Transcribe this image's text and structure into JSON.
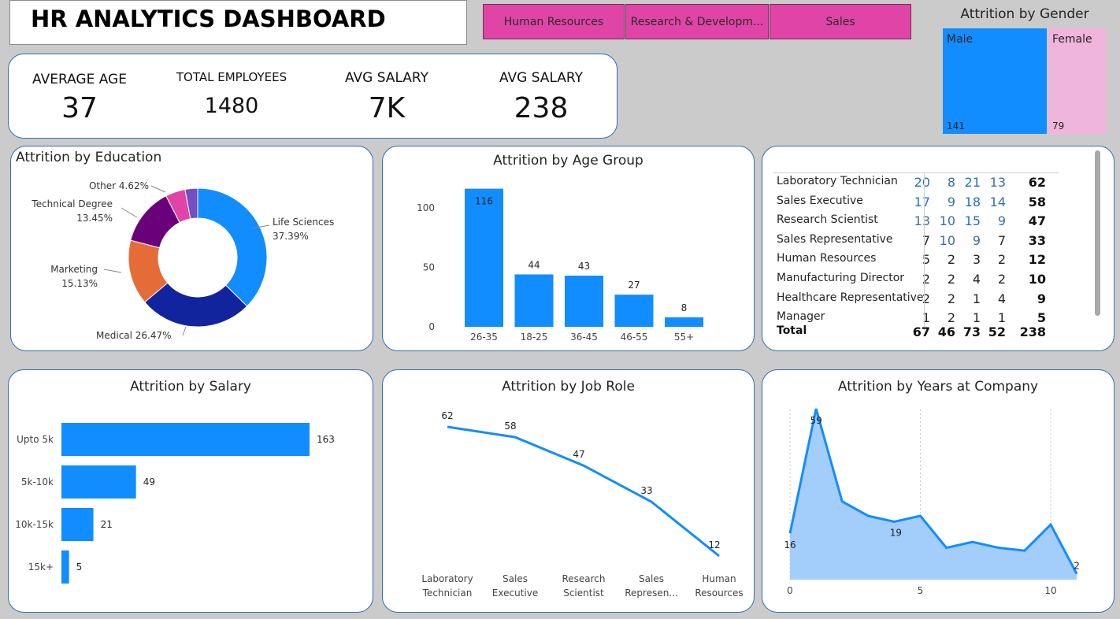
{
  "dashboard": {
    "title": "HR ANALYTICS DASHBOARD",
    "menu_dots": "..."
  },
  "slicer": {
    "buttons": [
      "Human Resources",
      "Research & Developm...",
      "Sales"
    ],
    "color": "#e044a7"
  },
  "kpis": [
    {
      "label": "AVERAGE AGE",
      "value": "37"
    },
    {
      "label": "TOTAL EMPLOYEES",
      "value": "1480"
    },
    {
      "label": "AVG SALARY",
      "value": "7K"
    },
    {
      "label": "AVG SALARY",
      "value": "238"
    }
  ],
  "gender": {
    "title": "Attrition by Gender",
    "male_label": "Male",
    "male_value": "141",
    "female_label": "Female",
    "female_value": "79",
    "male_color": "#118dff",
    "female_color": "#f0b5dc"
  },
  "matrix": {
    "rows": [
      {
        "role": "Laboratory Technician",
        "values": [
          "20",
          "8",
          "21",
          "13"
        ],
        "total": "62"
      },
      {
        "role": "Sales Executive",
        "values": [
          "17",
          "9",
          "18",
          "14"
        ],
        "total": "58"
      },
      {
        "role": "Research Scientist",
        "values": [
          "13",
          "10",
          "15",
          "9"
        ],
        "total": "47"
      },
      {
        "role": "Sales Representative",
        "values": [
          "7",
          "10",
          "9",
          "7"
        ],
        "total": "33"
      },
      {
        "role": "Human Resources",
        "values": [
          "5",
          "2",
          "3",
          "2"
        ],
        "total": "12"
      },
      {
        "role": "Manufacturing Director",
        "values": [
          "2",
          "2",
          "4",
          "2"
        ],
        "total": "10"
      },
      {
        "role": "Healthcare Representative",
        "values": [
          "2",
          "2",
          "1",
          "4"
        ],
        "total": "9"
      },
      {
        "role": "Manager",
        "values": [
          "1",
          "2",
          "1",
          "1"
        ],
        "total": "5"
      }
    ],
    "total_label": "Total",
    "totals": [
      "67",
      "46",
      "73",
      "52"
    ],
    "grand_total": "238"
  },
  "chart_data": [
    {
      "type": "pie",
      "title": "Attrition by Education",
      "categories": [
        "Life Sciences",
        "Medical",
        "Marketing",
        "Technical Degree",
        "Other",
        ""
      ],
      "values": [
        37.39,
        26.47,
        15.13,
        13.45,
        4.62,
        2.94
      ],
      "labels": [
        "37.39%",
        "26.47%",
        "15.13%",
        "13.45%",
        "4.62%",
        ""
      ],
      "colors": [
        "#118dff",
        "#12239e",
        "#e66c37",
        "#6b007b",
        "#e044a7",
        "#744ec2"
      ]
    },
    {
      "type": "bar",
      "title": "Attrition by Age Group",
      "categories": [
        "26-35",
        "18-25",
        "36-45",
        "46-55",
        "55+"
      ],
      "values": [
        116,
        44,
        43,
        27,
        8
      ],
      "yticks": [
        "0",
        "50",
        "100"
      ],
      "ylim": [
        0,
        125
      ],
      "color": "#118dff"
    },
    {
      "type": "bar",
      "orientation": "horizontal",
      "title": "Attrition by Salary",
      "categories": [
        "Upto 5k",
        "5k-10k",
        "10k-15k",
        "15k+"
      ],
      "values": [
        163,
        49,
        21,
        5
      ],
      "xlim": [
        0,
        163
      ],
      "color": "#118dff"
    },
    {
      "type": "line",
      "title": "Attrition by Job Role",
      "categories": [
        "Laboratory Technician",
        "Sales Executive",
        "Research Scientist",
        "Sales Represen...",
        "Human Resources"
      ],
      "category_lines": [
        [
          "Laboratory",
          "Technician"
        ],
        [
          "Sales",
          "Executive"
        ],
        [
          "Research",
          "Scientist"
        ],
        [
          "Sales",
          "Represen..."
        ],
        [
          "Human",
          "Resources"
        ]
      ],
      "values": [
        62,
        58,
        47,
        33,
        12
      ],
      "color": "#118dff"
    },
    {
      "type": "area",
      "title": "Attrition by Years at Company",
      "x": [
        0,
        1,
        2,
        3,
        4,
        5,
        6,
        7,
        8,
        9,
        10,
        11
      ],
      "values": [
        16,
        59,
        27,
        22,
        20,
        22,
        11,
        13,
        11,
        10,
        19,
        2
      ],
      "data_labels": {
        "0": "16",
        "1": "59",
        "4": "19",
        "11": "2"
      },
      "xticks": [
        "0",
        "5",
        "10"
      ],
      "line_color": "#118dff",
      "fill_color": "#a3cdfb"
    }
  ]
}
